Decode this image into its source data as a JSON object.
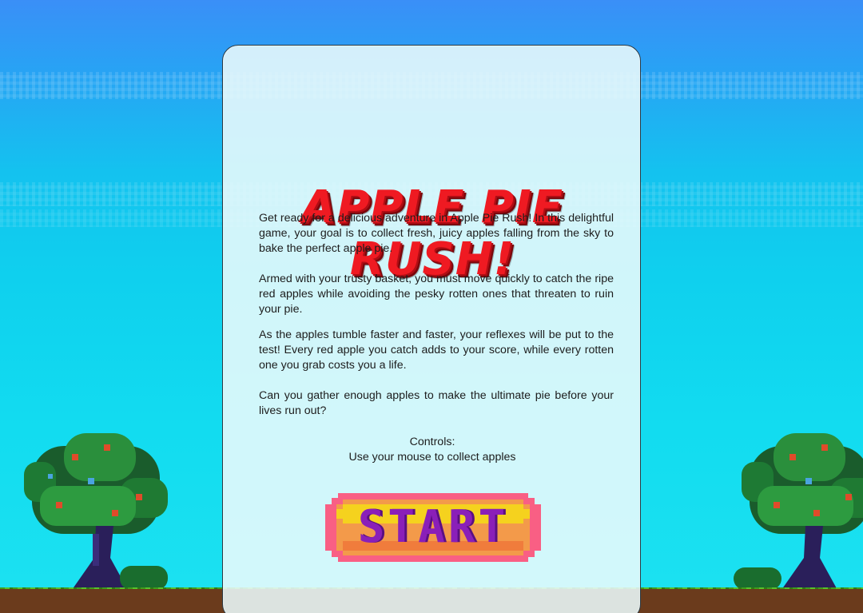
{
  "game": {
    "title": "APPLE PIE RUSH!",
    "description": [
      "Get ready for a delicious adventure in Apple Pie Rush! In this delightful game, your goal is to collect fresh, juicy apples falling from the sky to bake the perfect apple pie.",
      "Armed with your trusty basket, you must move quickly to catch the ripe red apples while avoiding the pesky rotten ones that threaten to ruin your pie.",
      "As the apples tumble faster and faster, your reflexes will be put to the test! Every red apple you catch adds to your score, while every rotten one you grab costs you a life.",
      "Can you gather enough apples to make the ultimate pie before your lives run out?"
    ],
    "controls_heading": "Controls:",
    "controls_text": "Use your mouse to collect apples",
    "start_label": "START"
  },
  "colors": {
    "title_red": "#ef1a22",
    "start_purple": "#8a1fb8",
    "start_yellow": "#f5d21e",
    "start_pink": "#f95f84"
  }
}
